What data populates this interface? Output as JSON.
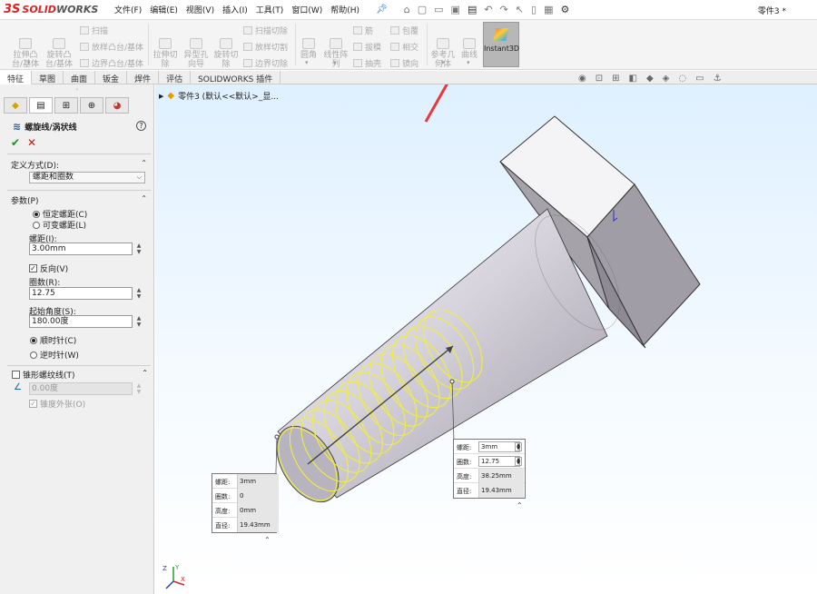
{
  "app": {
    "logo_mark": "3S",
    "logo_solid": "SOLID",
    "logo_works": "WORKS",
    "document_title": "零件3 *"
  },
  "menus": [
    "文件(F)",
    "编辑(E)",
    "视图(V)",
    "插入(I)",
    "工具(T)",
    "窗口(W)",
    "帮助(H)"
  ],
  "toolbar": {
    "boss_extrude": "拉伸凸\n台/基体",
    "boss_revolve": "旋转凸\n台/基体",
    "sweep": "扫描",
    "loft": "放样凸台/基体",
    "boundary_boss": "边界凸台/基体",
    "cut_extrude": "拉伸切\n除",
    "hole_wizard": "异型孔\n向导",
    "cut_revolve": "旋转切\n除",
    "cut_sweep": "扫描切除",
    "cut_loft": "放样切割",
    "cut_boundary": "边界切除",
    "fillet": "圆角",
    "linear_pattern": "线性阵\n列",
    "rib": "筋",
    "draft": "拔模",
    "shell": "抽壳",
    "wrap": "包覆",
    "intersect": "相交",
    "mirror": "镜向",
    "ref_geometry": "参考几\n何体",
    "curves": "曲线",
    "instant3d": "Instant3D"
  },
  "tabs": [
    "特征",
    "草图",
    "曲面",
    "钣金",
    "焊件",
    "评估",
    "SOLIDWORKS 插件"
  ],
  "panel": {
    "title": "螺旋线/涡状线",
    "help": "?",
    "ok": "✔",
    "cancel": "✕",
    "definition": {
      "header": "定义方式(D):",
      "selected": "螺距和圈数"
    },
    "params": {
      "header": "参数(P)",
      "constant_pitch": "恒定螺距(C)",
      "variable_pitch": "可变螺距(L)",
      "pitch_label": "螺距(I):",
      "pitch_value": "3.00mm",
      "reverse": "反向(V)",
      "revolutions_label": "圈数(R):",
      "revolutions_value": "12.75",
      "start_angle_label": "起始角度(S):",
      "start_angle_value": "180.00度",
      "clockwise": "顺时针(C)",
      "counterclockwise": "逆时针(W)"
    },
    "taper": {
      "header": "锥形螺纹线(T)",
      "angle_value": "0.00度",
      "taper_outward": "锥度外张(O)"
    }
  },
  "viewport": {
    "tree_label": "零件3 (默认<<默认>_显...",
    "callout_start": {
      "rows": [
        {
          "key": "螺距:",
          "value": "3mm"
        },
        {
          "key": "圈数:",
          "value": "0"
        },
        {
          "key": "高度:",
          "value": "0mm"
        },
        {
          "key": "直径:",
          "value": "19.43mm"
        }
      ]
    },
    "callout_end": {
      "rows": [
        {
          "key": "螺距:",
          "value": "3mm"
        },
        {
          "key": "圈数:",
          "value": "12.75"
        },
        {
          "key": "高度:",
          "value": "38.25mm"
        },
        {
          "key": "直径:",
          "value": "19.43mm"
        }
      ]
    },
    "triad": {
      "x": "X",
      "y": "Y",
      "z": "Z"
    }
  },
  "colors": {
    "helix": "#f2ee3a",
    "annotation_arrow": "#e8383d",
    "instant3d_bg": "#b7b7b7"
  }
}
